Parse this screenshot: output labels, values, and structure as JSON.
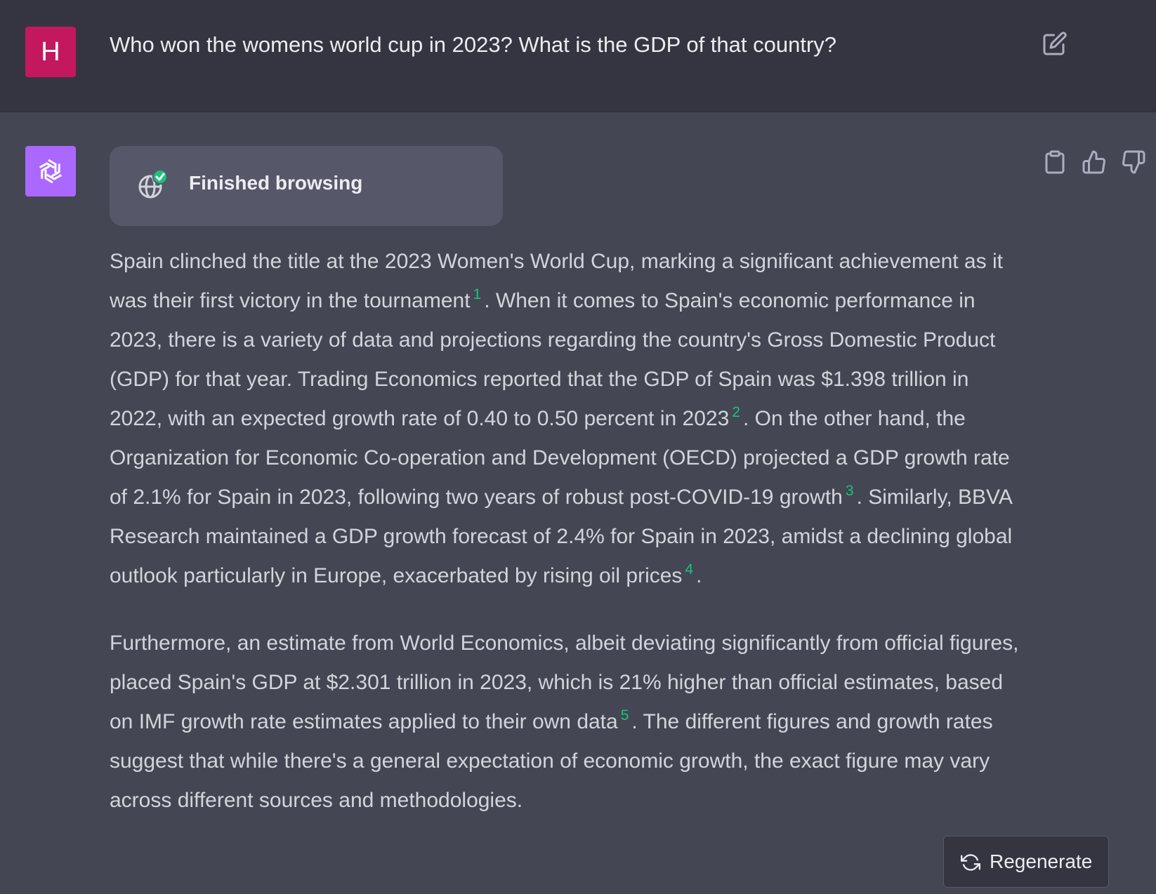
{
  "user": {
    "avatar_initial": "H",
    "message": "Who won the womens world cup in 2023? What is the GDP of that country?"
  },
  "assistant": {
    "browsing_status": "Finished browsing",
    "paragraph1": {
      "s1": "Spain clinched the title at the 2023 Women's World Cup, marking a significant achievement as it was their first victory in the tournament",
      "c1": "1",
      "s2": ". When it comes to Spain's economic performance in 2023, there is a variety of data and projections regarding the country's Gross Domestic Product (GDP) for that year. Trading Economics reported that the GDP of Spain was $1.398 trillion in 2022, with an expected growth rate of 0.40 to 0.50 percent in 2023",
      "c2": "2",
      "s3": ". On the other hand, the Organization for Economic Co-operation and Development (OECD) projected a GDP growth rate of 2.1% for Spain in 2023, following two years of robust post-COVID-19 growth",
      "c3": "3",
      "s4": ". Similarly, BBVA Research maintained a GDP growth forecast of 2.4% for Spain in 2023, amidst a declining global outlook particularly in Europe, exacerbated by rising oil prices",
      "c4": "4",
      "s5": "."
    },
    "paragraph2": {
      "s1": "Furthermore, an estimate from World Economics, albeit deviating significantly from official figures, placed Spain's GDP at $2.301 trillion in 2023, which is 21% higher than official estimates, based on IMF growth rate estimates applied to their own data",
      "c5": "5",
      "s2": ". The different figures and growth rates suggest that while there's a general expectation of economic growth, the exact figure may vary across different sources and methodologies."
    }
  },
  "regenerate_label": "Regenerate",
  "icons": {
    "edit": "edit-icon",
    "copy": "clipboard-icon",
    "like": "thumbs-up-icon",
    "dislike": "thumbs-down-icon",
    "browse": "globe-check-icon",
    "regenerate": "refresh-icon",
    "assistant_logo": "openai-logo-icon"
  },
  "colors": {
    "user_bg": "#343541",
    "assistant_bg": "#444654",
    "user_avatar": "#c4185e",
    "assistant_avatar": "#ab68ff",
    "citation": "#19c37d"
  }
}
